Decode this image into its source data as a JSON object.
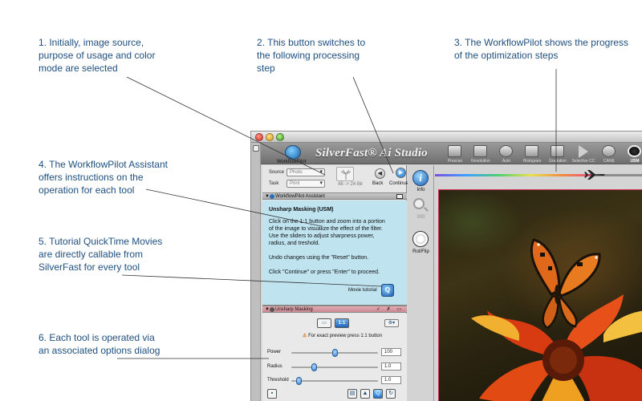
{
  "callouts": [
    {
      "id": "callout-1",
      "lines": [
        "1. Initially, image source,",
        "purpose of usage and color",
        "mode are selected"
      ]
    },
    {
      "id": "callout-2",
      "lines": [
        "2. This button switches to",
        "the following processing",
        "step"
      ]
    },
    {
      "id": "callout-3",
      "lines": [
        "3. The WorkflowPilot shows the progress",
        "of the optimization steps"
      ]
    },
    {
      "id": "callout-4",
      "lines": [
        "4. The WorkflowPilot Assistant",
        "offers instructions on the",
        "operation for each tool"
      ]
    },
    {
      "id": "callout-5",
      "lines": [
        "5. Tutorial QuickTime Movies",
        "are directly callable from",
        "SilverFast for every tool"
      ]
    },
    {
      "id": "callout-6",
      "lines": [
        "6. Each tool is operated via",
        "an associated options dialog"
      ]
    }
  ],
  "app": {
    "brand": "SilverFast® Ai Studio",
    "workflowpilot_label": "WorkflowPilot",
    "tools": [
      {
        "label": "Prescan",
        "shape": "square"
      },
      {
        "label": "Resolution",
        "shape": "square"
      },
      {
        "label": "Auto",
        "shape": "circle"
      },
      {
        "label": "Histogram",
        "shape": "square"
      },
      {
        "label": "Gradation",
        "shape": "square"
      },
      {
        "label": "Selective CC",
        "shape": "triangle"
      },
      {
        "label": "CANE",
        "shape": "circle"
      },
      {
        "label": "USM",
        "shape": "active"
      },
      {
        "label": "File",
        "shape": "square"
      }
    ]
  },
  "source_panel": {
    "source_label": "Source",
    "source_value": "Photo",
    "task_label": "Task",
    "task_value": "Print",
    "bits": "48 -> 24 Bit",
    "back_label": "Back",
    "continue_label": "Continue"
  },
  "assistant": {
    "title": "WorkflowPilot Assistant",
    "heading": "Unsharp Masking (USM)",
    "lines": [
      "Click on the 1:1 button and zoom into a portion",
      "of the image to visualize the effect of the filter.",
      "Use the sliders to adjust sharpness power,",
      "radius, and treshold.",
      "",
      "Undo changes using the \"Reset\" button.",
      "",
      "Click \"Continue\" or press \"Enter\" to proceed."
    ],
    "movie_label": "Movie tutorial"
  },
  "usm": {
    "title": "Unsharp Masking",
    "header_icons": "✓ ✗ ▭",
    "seg_label": "1:1",
    "warning_text": "For exact preview press 1:1 button",
    "params": [
      {
        "label": "Power",
        "value": "100",
        "fraction": 0.5
      },
      {
        "label": "Radius",
        "value": "1.0",
        "fraction": 0.25
      },
      {
        "label": "Threshold",
        "value": "1.0",
        "fraction": 0.06
      }
    ]
  },
  "midstrip": {
    "info_label": "Info",
    "zoom_value": "999",
    "rotflip_label": "Rot/Flip"
  },
  "workflow_progress": 0.77,
  "colors": {
    "callout_text": "#1e4f80",
    "accent_blue": "#1a6fd0",
    "usm_header": "#e6aab2",
    "assistant_bg": "#bfe4f0"
  }
}
